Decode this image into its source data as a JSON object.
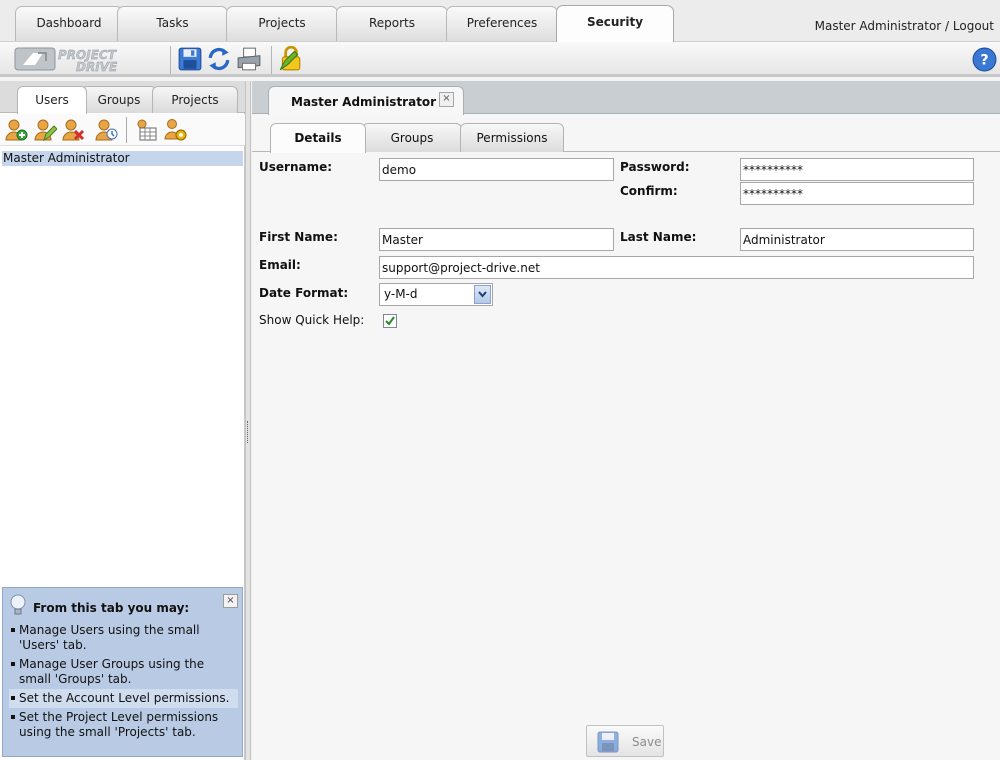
{
  "nav": {
    "tabs": [
      {
        "label": "Dashboard"
      },
      {
        "label": "Tasks"
      },
      {
        "label": "Projects"
      },
      {
        "label": "Reports"
      },
      {
        "label": "Preferences"
      },
      {
        "label": "Security"
      }
    ],
    "active_tab": "Security",
    "user_name": "Master Administrator",
    "separator": " / ",
    "logout_label": "Logout"
  },
  "toolbar": {
    "logo_text_line1": "PROJECT",
    "logo_text_line2": "DRIVE",
    "icons": [
      "save-icon",
      "refresh-icon",
      "print-icon",
      "edit-lock-icon",
      "help-icon"
    ]
  },
  "left_panel": {
    "tabs": [
      {
        "label": "Users"
      },
      {
        "label": "Groups"
      },
      {
        "label": "Projects"
      }
    ],
    "active_tab": "Users",
    "action_icons": [
      "add-user-icon",
      "edit-user-icon",
      "delete-user-icon",
      "user-history-icon",
      "user-grid-icon",
      "user-settings-icon"
    ],
    "users": [
      {
        "name": "Master Administrator",
        "selected": true
      }
    ]
  },
  "quick_help": {
    "title": "From this tab you may:",
    "close_label": "×",
    "items": [
      {
        "text": "Manage Users using the small 'Users' tab."
      },
      {
        "text": "Manage User Groups using the small 'Groups' tab."
      },
      {
        "text": "Set the Account Level permissions."
      },
      {
        "text": "Set the Project Level permissions using the small 'Projects' tab."
      }
    ]
  },
  "doc_tab": {
    "title": "Master Administrator",
    "close_label": "×"
  },
  "detail_tabs": [
    {
      "label": "Details"
    },
    {
      "label": "Groups"
    },
    {
      "label": "Permissions"
    }
  ],
  "active_detail_tab": "Details",
  "form": {
    "username_label": "Username:",
    "username": "demo",
    "password_label": "Password:",
    "password": "**********",
    "confirm_label": "Confirm:",
    "confirm": "**********",
    "first_name_label": "First Name:",
    "first_name": "Master",
    "last_name_label": "Last Name:",
    "last_name": "Administrator",
    "email_label": "Email:",
    "email": "support@project-drive.net",
    "date_format_label": "Date Format:",
    "date_format": "y-M-d",
    "quick_help_label": "Show Quick Help:",
    "quick_help_checked": true,
    "save_label": "Save"
  },
  "colors": {
    "selection": "#c5d5eb",
    "quick_help_bg": "#b9cbe4",
    "icon_blue": "#2a66c7",
    "icon_user": "#e2a43a"
  }
}
